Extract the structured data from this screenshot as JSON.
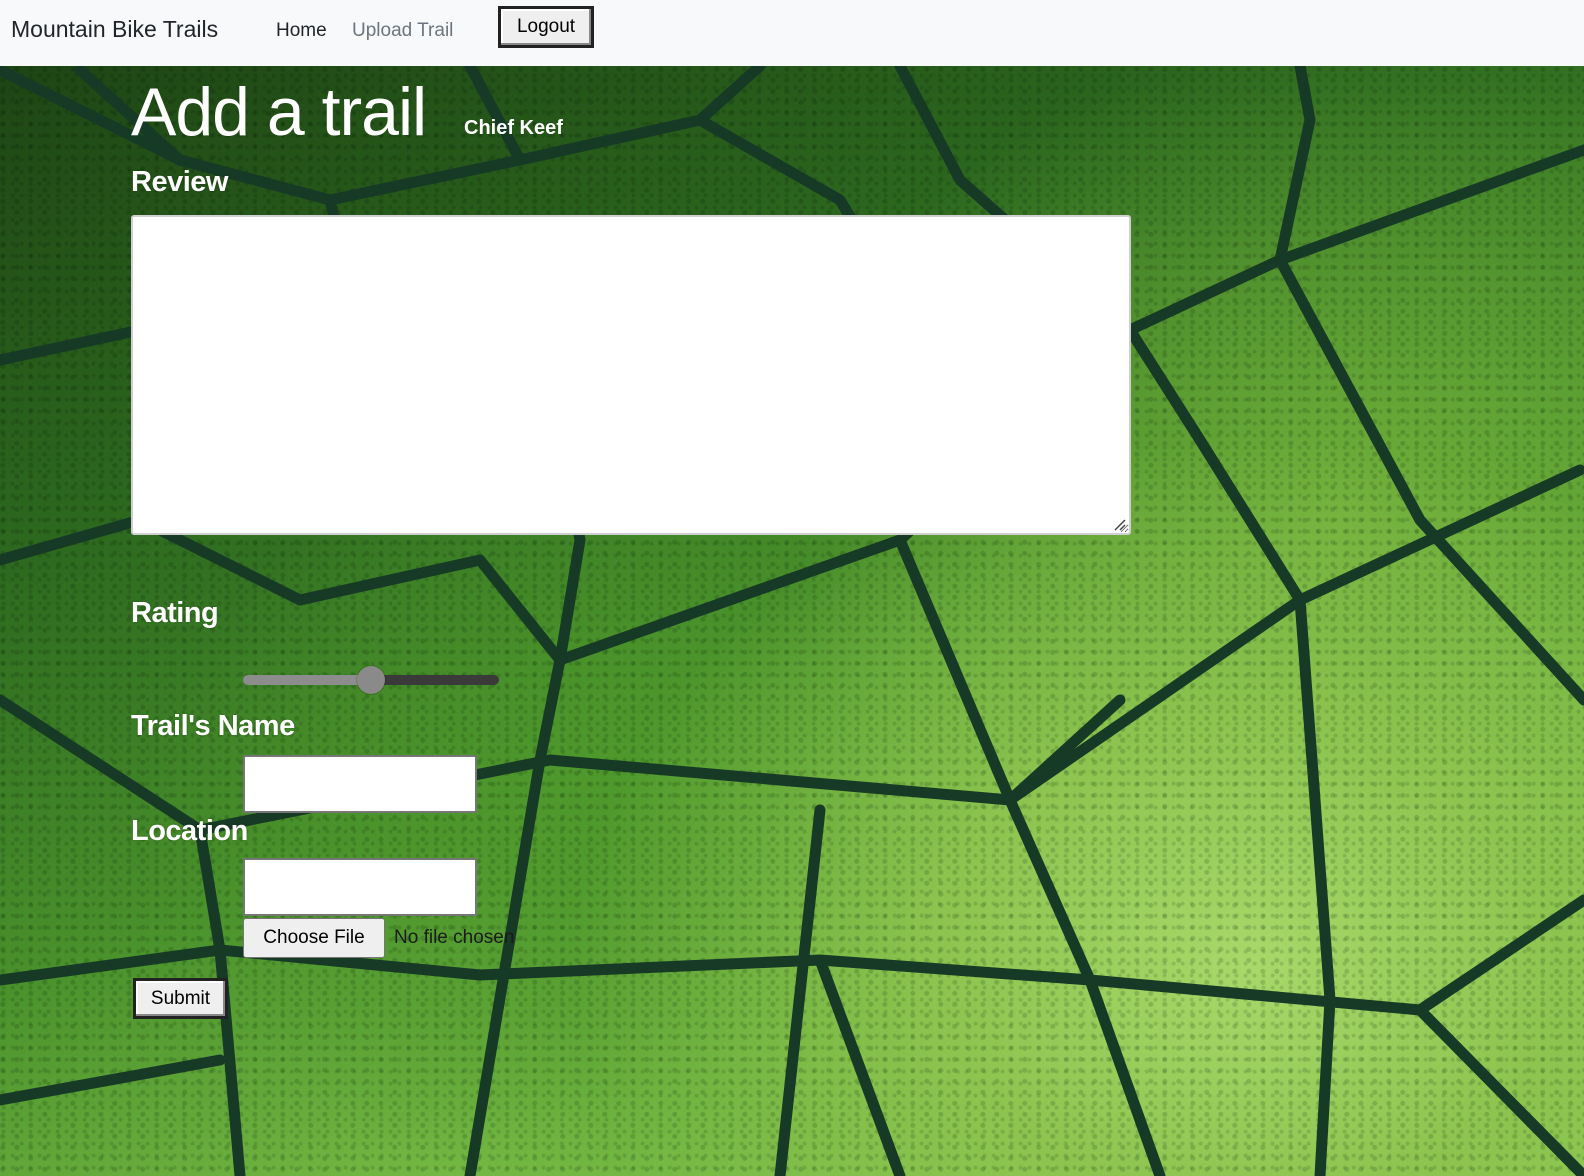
{
  "navbar": {
    "brand": "Mountain Bike Trails",
    "links": [
      {
        "label": "Home"
      },
      {
        "label": "Upload Trail"
      }
    ],
    "logout_label": "Logout"
  },
  "form": {
    "title": "Add a trail",
    "author": "Chief Keef",
    "review": {
      "label": "Review",
      "value": ""
    },
    "rating": {
      "label": "Rating",
      "value_fraction": 0.5
    },
    "trail_name": {
      "label": "Trail's Name",
      "value": ""
    },
    "location": {
      "label": "Location",
      "value": ""
    },
    "file": {
      "button_label": "Choose File",
      "status": "No file chosen"
    },
    "submit_label": "Submit"
  },
  "colors": {
    "navbar_bg": "#f8f9fa",
    "muted_link": "#6c757d",
    "label_text": "#ffffff",
    "background_green": "#4a922c"
  }
}
